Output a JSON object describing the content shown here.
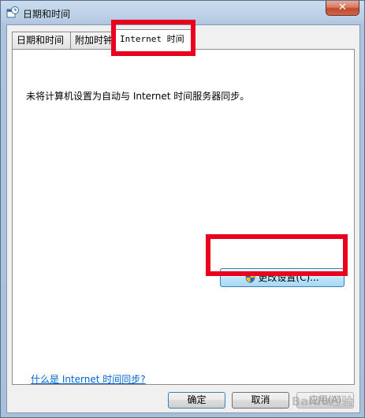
{
  "window": {
    "title": "日期和时间",
    "close_label": "✕"
  },
  "tabs": [
    {
      "label": "日期和时间",
      "active": false
    },
    {
      "label": "附加时钟",
      "active": false
    },
    {
      "label": "Internet 时间",
      "active": true
    }
  ],
  "panel": {
    "status_text": "未将计算机设置为自动与 Internet 时间服务器同步。",
    "change_button_label": "更改设置(C)...",
    "help_link": "什么是 Internet 时间同步?"
  },
  "footer": {
    "ok_label": "确定",
    "cancel_label": "取消",
    "apply_label": "应用(A)"
  },
  "watermark": "Baidu经验",
  "colors": {
    "annotation": "#e8001c",
    "link": "#0066cc"
  }
}
